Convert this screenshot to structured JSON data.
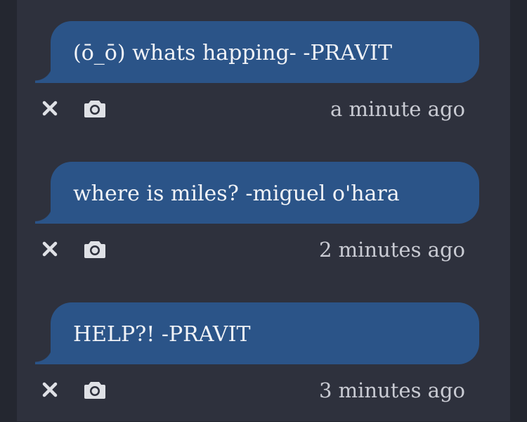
{
  "messages": [
    {
      "text": "(ō_ō) whats happing- -PRAVIT",
      "time": "a minute ago",
      "actions": {
        "delete_icon": "close-icon",
        "snapshot_icon": "camera-icon"
      }
    },
    {
      "text": "where is miles? -miguel o'hara",
      "time": "2 minutes ago",
      "actions": {
        "delete_icon": "close-icon",
        "snapshot_icon": "camera-icon"
      }
    },
    {
      "text": "HELP?! -PRAVIT",
      "time": "3 minutes ago",
      "actions": {
        "delete_icon": "close-icon",
        "snapshot_icon": "camera-icon"
      }
    }
  ],
  "colors": {
    "background": "#242730",
    "panel": "#2e313d",
    "bubble": "#2b5488",
    "bubble_text": "#f1f3f7",
    "icon": "#dfe1e6",
    "timestamp": "#c9cbd3"
  }
}
